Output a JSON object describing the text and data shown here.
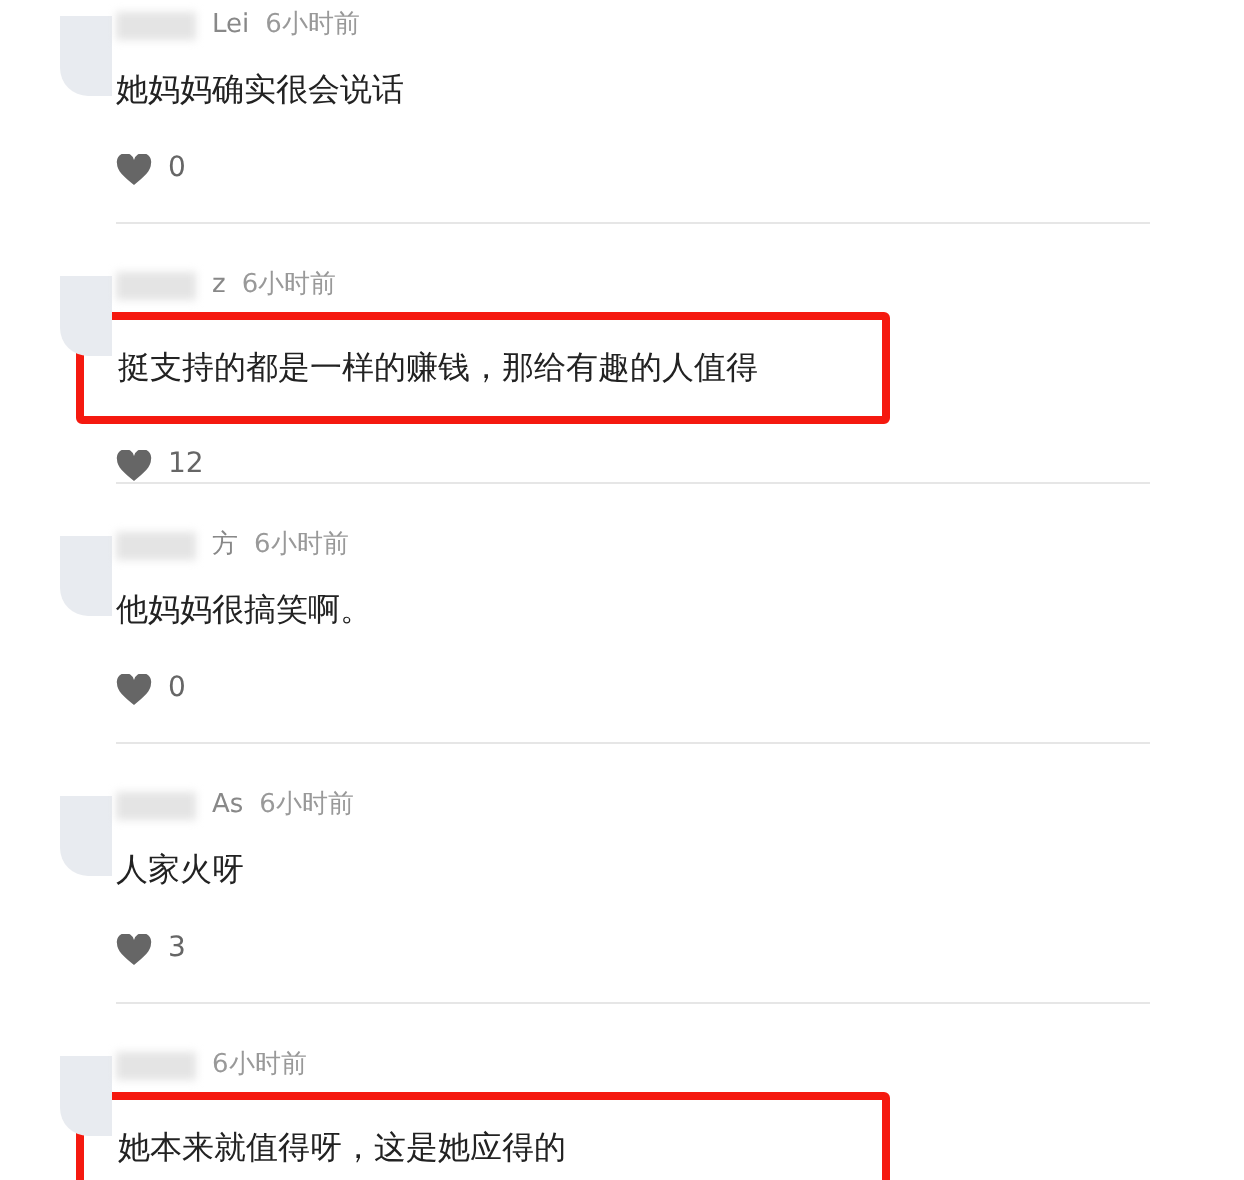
{
  "comments": [
    {
      "user": "Lei",
      "time": "6小时前",
      "text": "她妈妈确实很会说话",
      "likes": "0",
      "highlighted": false
    },
    {
      "user": "z",
      "time": "6小时前",
      "text": "挺支持的都是一样的赚钱，那给有趣的人值得",
      "likes": "12",
      "highlighted": true
    },
    {
      "user": "方",
      "time": "6小时前",
      "text": "他妈妈很搞笑啊。",
      "likes": "0",
      "highlighted": false
    },
    {
      "user": "As",
      "time": "6小时前",
      "text": "人家火呀",
      "likes": "3",
      "highlighted": false
    },
    {
      "time": "6小时前",
      "text": "她本来就值得呀，这是她应得的",
      "highlighted": true
    }
  ]
}
